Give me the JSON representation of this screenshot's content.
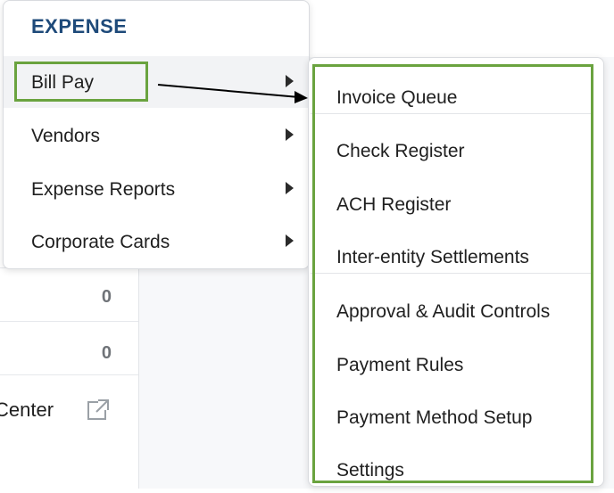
{
  "background": {
    "counts": [
      "0",
      "0"
    ],
    "link_label": "Center"
  },
  "menu": {
    "title": "EXPENSE",
    "items": [
      {
        "label": "Bill Pay"
      },
      {
        "label": "Vendors"
      },
      {
        "label": "Expense Reports"
      },
      {
        "label": "Corporate Cards"
      }
    ]
  },
  "submenu": {
    "items": [
      {
        "label": "Invoice Queue"
      },
      {
        "label": "Check Register"
      },
      {
        "label": "ACH Register"
      },
      {
        "label": "Inter-entity Settlements"
      },
      {
        "label": "Approval & Audit Controls"
      },
      {
        "label": "Payment Rules"
      },
      {
        "label": "Payment Method Setup"
      },
      {
        "label": "Settings"
      }
    ]
  },
  "colors": {
    "highlight": "#6aa33f",
    "section_title": "#1e4a7a"
  }
}
